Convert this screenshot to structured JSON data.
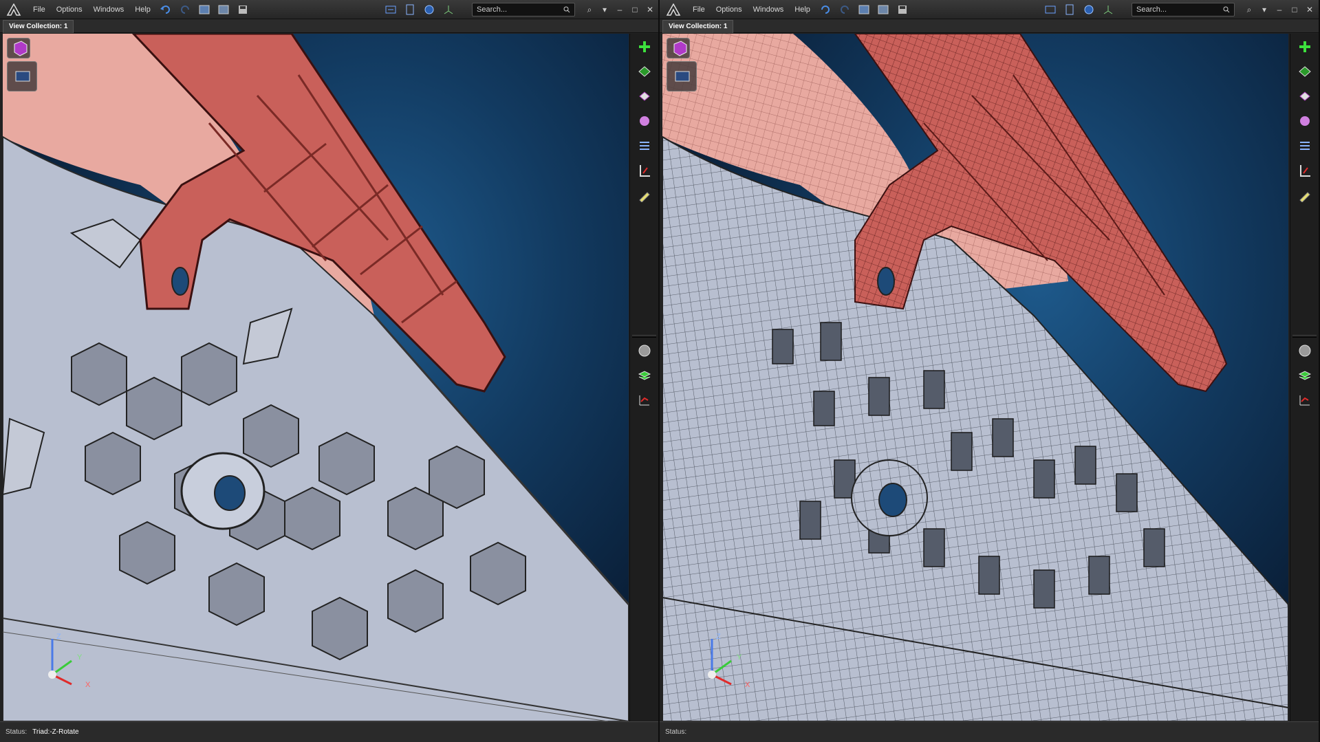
{
  "menus": [
    "File",
    "Options",
    "Windows",
    "Help"
  ],
  "search_placeholder": "Search...",
  "panes": [
    {
      "tab": "View Collection: 1",
      "status_label": "Status:",
      "status_value": "Triad:-Z-Rotate"
    },
    {
      "tab": "View Collection: 1",
      "status_label": "Status:",
      "status_value": ""
    }
  ],
  "triad": {
    "x": "X",
    "y": "Y",
    "z": "Z"
  },
  "colors": {
    "bracket": "#c9605a",
    "bracket_light": "#e8a9a0",
    "plate": "#b8bfd0",
    "background": "#123a60"
  },
  "icons": {
    "toolbar": [
      "undo-icon",
      "redo-icon",
      "save-icon",
      "save-as-icon",
      "floppy-icon",
      "fit-view-icon",
      "page-view-icon",
      "globe-view-icon",
      "axis-view-icon"
    ],
    "sidebar_top": [
      "add-node-icon",
      "plane-icon",
      "eraser-icon",
      "flower-icon",
      "list-icon",
      "measure-icon",
      "pencil-icon"
    ],
    "sidebar_bottom": [
      "sphere-icon",
      "stack-icon",
      "graph-icon"
    ]
  }
}
